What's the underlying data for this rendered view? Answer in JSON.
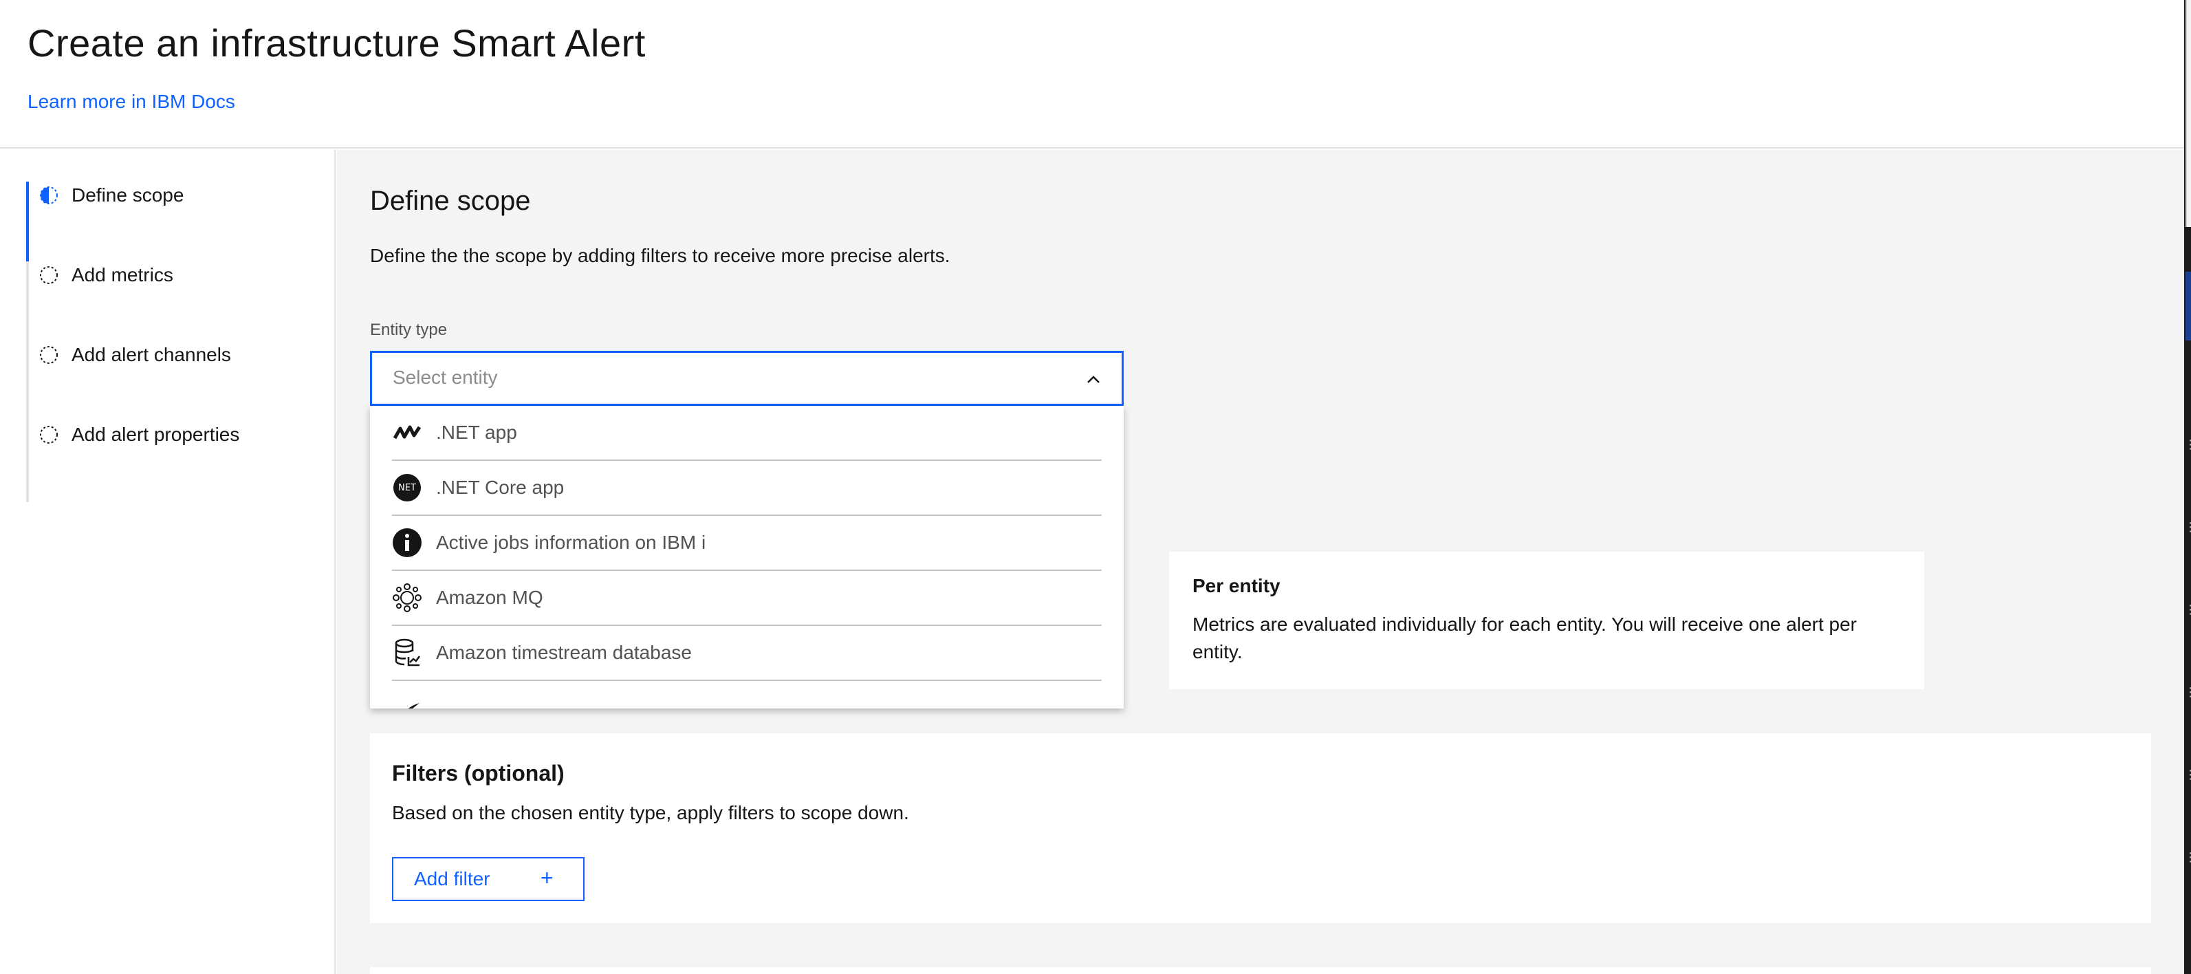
{
  "header": {
    "title": "Create an infrastructure Smart Alert",
    "docs_link": "Learn more in IBM Docs"
  },
  "steps": [
    {
      "label": "Define scope",
      "state": "current"
    },
    {
      "label": "Add metrics",
      "state": "incomplete"
    },
    {
      "label": "Add alert channels",
      "state": "incomplete"
    },
    {
      "label": "Add alert properties",
      "state": "incomplete"
    }
  ],
  "scope": {
    "title": "Define scope",
    "description": "Define the the scope by adding filters to receive more precise alerts.",
    "entity_label": "Entity type",
    "entity_placeholder": "Select entity"
  },
  "entity_options": [
    {
      "label": ".NET app",
      "icon": "dotnet-wave-icon"
    },
    {
      "label": ".NET Core app",
      "icon": "dotnet-core-icon"
    },
    {
      "label": "Active jobs information on IBM i",
      "icon": "info-circle-icon"
    },
    {
      "label": "Amazon MQ",
      "icon": "amazon-mq-icon"
    },
    {
      "label": "Amazon timestream database",
      "icon": "database-icon"
    }
  ],
  "per_entity": {
    "title": "Per entity",
    "text": "Metrics are evaluated individually for each entity. You will receive one alert per entity."
  },
  "filters": {
    "title": "Filters (optional)",
    "description": "Based on the chosen entity type, apply filters to scope down.",
    "add_label": "Add filter",
    "add_icon": "+"
  },
  "colors": {
    "accent": "#0f62fe",
    "background": "#f4f4f4",
    "text": "#161616"
  }
}
